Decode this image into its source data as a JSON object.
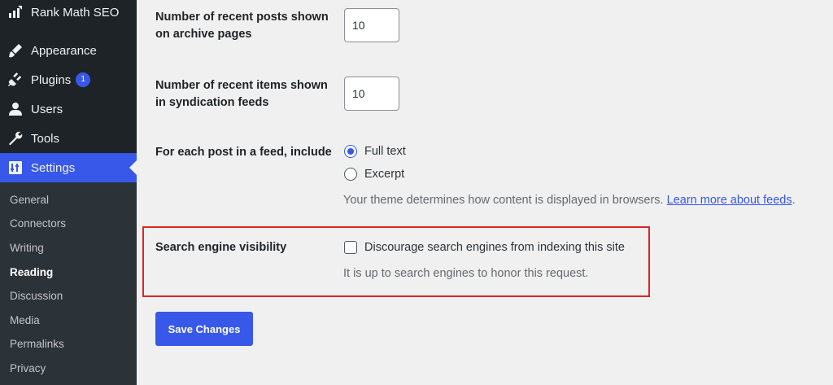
{
  "sidebar": {
    "top_item": {
      "label": "Rank Math SEO",
      "icon": "rank-math-icon"
    },
    "items": [
      {
        "label": "Appearance",
        "icon": "paintbrush-icon"
      },
      {
        "label": "Plugins",
        "icon": "plugin-icon",
        "badge": "1"
      },
      {
        "label": "Users",
        "icon": "user-icon"
      },
      {
        "label": "Tools",
        "icon": "wrench-icon"
      },
      {
        "label": "Settings",
        "icon": "settings-icon",
        "active": true
      }
    ],
    "submenu": [
      "General",
      "Connectors",
      "Writing",
      "Reading",
      "Discussion",
      "Media",
      "Permalinks",
      "Privacy"
    ],
    "current_submenu": "Reading"
  },
  "settings": {
    "archive_posts": {
      "label": "Number of recent posts shown on archive pages",
      "value": "10"
    },
    "feed_items": {
      "label": "Number of recent items shown in syndication feeds",
      "value": "10"
    },
    "feed_include": {
      "label": "For each post in a feed, include",
      "options": [
        "Full text",
        "Excerpt"
      ],
      "selected": "Full text",
      "description": "Your theme determines how content is displayed in browsers.",
      "link_text": "Learn more about feeds"
    },
    "search_visibility": {
      "label": "Search engine visibility",
      "checkbox_label": "Discourage search engines from indexing this site",
      "checked": false,
      "description": "It is up to search engines to honor this request."
    },
    "save_label": "Save Changes"
  },
  "colors": {
    "accent": "#3858e9",
    "sidebar_bg": "#1d2327",
    "highlight_border": "#e02424"
  }
}
